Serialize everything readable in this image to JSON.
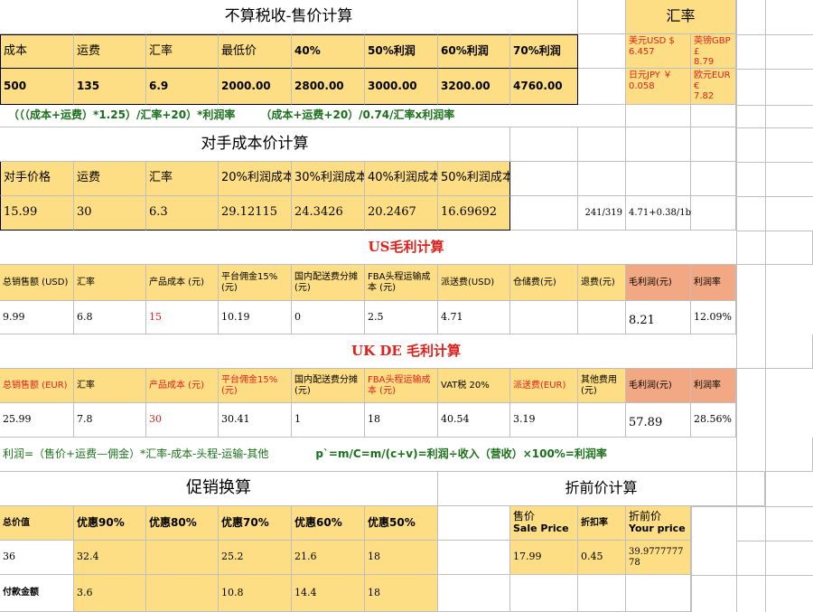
{
  "pricing": {
    "title": "不算税收-售价计算",
    "headers": [
      "成本",
      "运费",
      "汇率",
      "最低价",
      "40%",
      "50%利润",
      "60%利润",
      "70%利润"
    ],
    "values": [
      "500",
      "135",
      "6.9",
      "2000.00",
      "2800.00",
      "3000.00",
      "3200.00",
      "4760.00"
    ],
    "formula_a": "（（（成本+运费）*1.25）/汇率+20）*利润率",
    "formula_b": "（成本+运费+20）/0.74/汇率x利润率"
  },
  "exchange": {
    "title": "汇率",
    "usd_label": "美元USD  $",
    "usd_value": "6.457",
    "gbp_label": "英镑GBP  £",
    "gbp_value": "8.79",
    "jpy_label": "日元JPY  ￥",
    "jpy_value": "0.058",
    "eur_label": "欧元EUR  €",
    "eur_value": "7.82"
  },
  "competitor": {
    "title": "对手成本价计算",
    "headers": [
      "对手价格",
      "运费",
      "汇率",
      "20%利润成本",
      "30%利润成本",
      "40%利润成本",
      "50%利润成本"
    ],
    "values": [
      "15.99",
      "30",
      "6.3",
      "29.12115",
      "24.3426",
      "20.2467",
      "16.69692"
    ],
    "note_ratio": "241/319",
    "note_formula": "4.71+0.38/1b"
  },
  "us_margin": {
    "title": "US毛利计算",
    "headers": [
      "总销售额 (USD)",
      "汇率",
      "产品成本 (元)",
      "平台佣金15% (元)",
      "国内配送费分摊 (元)",
      "FBA头程运输成本 (元)",
      "派送费(USD)",
      "仓储费(元)",
      "退费(元)",
      "毛利润(元)",
      "利润率"
    ],
    "values": [
      "9.99",
      "6.8",
      "15",
      "10.19",
      "0",
      "2.5",
      "4.71",
      "",
      "",
      "8.21",
      "12.09%"
    ]
  },
  "uk_margin": {
    "title": "UK DE 毛利计算",
    "headers": [
      "总销售额 (EUR)",
      "汇率",
      "产品成本 (元)",
      "平台佣金15% (元)",
      "国内配送费分摊 (元)",
      "FBA头程运输成本 (元)",
      "VAT税 20%",
      "派送费(EUR)",
      "其他费用 (元)",
      "毛利润(元)",
      "利润率"
    ],
    "values": [
      "25.99",
      "7.8",
      "30",
      "30.41",
      "1",
      "18",
      "40.54",
      "3.19",
      "",
      "57.89",
      "28.56%"
    ],
    "formula_a": "利润=（售价+运费—佣金）*汇率-成本-头程-运输-其他",
    "formula_b": "p`=m/C=m/(c+v)=利润÷收入（营收）×100%=利润率"
  },
  "promo": {
    "title": "促销换算",
    "headers": [
      "总价值",
      "优惠90%",
      "优惠80%",
      "优惠70%",
      "优惠60%",
      "优惠50%"
    ],
    "values": [
      "36",
      "32.4",
      "",
      "25.2",
      "21.6",
      "18"
    ],
    "pay_label": "付款金额",
    "pay_values": [
      "3.6",
      "",
      "10.8",
      "14.4",
      "18"
    ]
  },
  "discount": {
    "title": "折前价计算",
    "sale_cn": "售价",
    "sale_en": "Sale Price",
    "rate_label": "折扣率",
    "your_cn": "折前价",
    "your_en": "Your price",
    "sale_value": "17.99",
    "rate_value": "0.45",
    "your_value": "39.977777778"
  }
}
